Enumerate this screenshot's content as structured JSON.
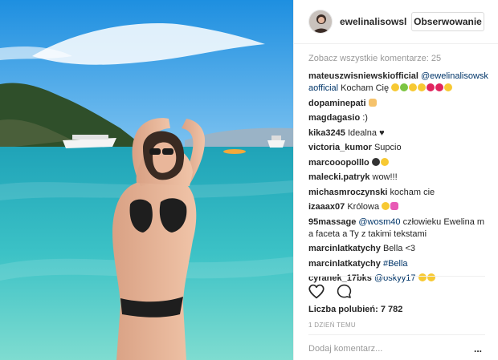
{
  "header": {
    "username": "ewelinalisowsl",
    "follow_label": "Obserwowanie"
  },
  "view_all_label": "Zobacz wszystkie komentarze: 25",
  "comments": [
    {
      "user": "mateuszwisniewskiofficial",
      "mention": "@ewelinalisowskaofficial",
      "text": "Kocham Cię",
      "emojis": [
        "heart-eyes",
        "green-hearts",
        "star-face",
        "heart-eyes",
        "red-heart",
        "red-heart",
        "grin"
      ]
    },
    {
      "user": "dopaminepati",
      "text": "",
      "emojis": [
        "pointing-hand"
      ]
    },
    {
      "user": "magdagasio",
      "text": ":)"
    },
    {
      "user": "kika3245",
      "text": "Idealna ♥"
    },
    {
      "user": "victoria_kumor",
      "text": "Supcio"
    },
    {
      "user": "marcooopolllo",
      "text": "",
      "emojis": [
        "bomb",
        "smirk"
      ]
    },
    {
      "user": "malecki.patryk",
      "text": "wow!!!"
    },
    {
      "user": "michasmroczynski",
      "text": "kocham cie"
    },
    {
      "user": "izaaax07",
      "text": "Królowa",
      "emojis": [
        "blush",
        "pink-heart"
      ]
    },
    {
      "user": "95massage",
      "mention": "@wosm40",
      "text": "człowieku Ewelina ma faceta a Ty z takimi tekstami"
    },
    {
      "user": "marcinlatkatychy",
      "text": "Bella <3"
    },
    {
      "user": "marcinlatkatychy",
      "mention": "#Bella"
    },
    {
      "user": "cyranek_17bks",
      "mention": "@oskyy17",
      "emojis": [
        "joy",
        "joy"
      ]
    }
  ],
  "likes_label": "Liczba polubień: 7 782",
  "time_label": "1 DZIEŃ TEMU",
  "comment_input": {
    "placeholder": "Dodaj komentarz..."
  },
  "more_label": "...",
  "icons": {
    "like": "heart-outline-icon",
    "comment": "speech-bubble-icon",
    "options": "ellipsis-icon"
  },
  "colors": {
    "link": "#003569",
    "muted": "#999999",
    "border": "#efefef",
    "sea": "#3fb8c6"
  }
}
